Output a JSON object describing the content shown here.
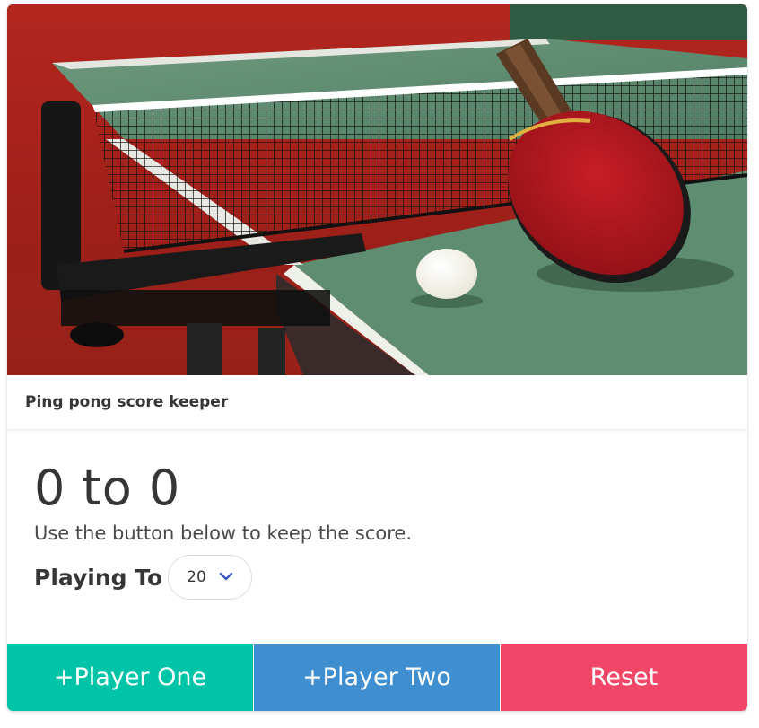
{
  "header": {
    "title": "Ping pong score keeper"
  },
  "score": {
    "player_one": "0",
    "separator": "to",
    "player_two": "0",
    "text": "0 to 0"
  },
  "instructions": "Use the button below to keep the score.",
  "playing_to": {
    "label": "Playing To",
    "selected": "20",
    "icon": "chevron-down-icon"
  },
  "buttons": {
    "player_one": "+Player One",
    "player_two": "+Player Two",
    "reset": "Reset"
  },
  "image": {
    "subject": "ping-pong-table-photo"
  },
  "colors": {
    "player_one": "#00c4a7",
    "player_two": "#3e8ed0",
    "reset": "#f14668",
    "chevron": "#3e56c4"
  }
}
